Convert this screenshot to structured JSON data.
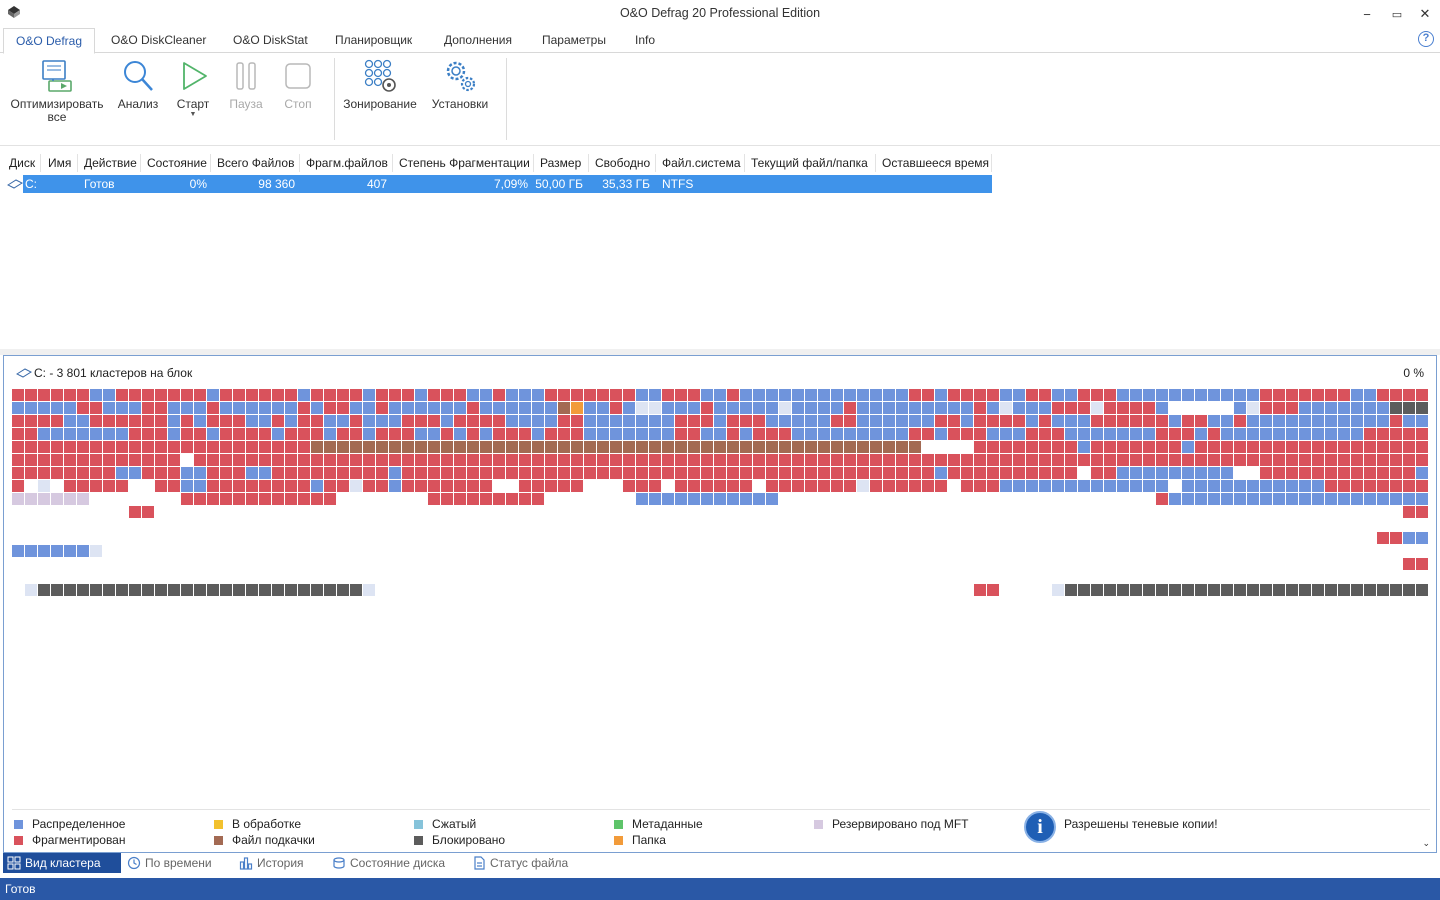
{
  "window": {
    "title": "O&O Defrag 20 Professional Edition",
    "minimize_glyph": "−",
    "maximize_glyph": "▭",
    "close_glyph": "✕"
  },
  "menu": {
    "tabs": [
      "O&O Defrag",
      "O&O DiskCleaner",
      "O&O DiskStat",
      "Планировщик",
      "Дополнения",
      "Параметры",
      "Info"
    ],
    "active_index": 0,
    "help_glyph": "?"
  },
  "ribbon": {
    "optimize_all_line1": "Оптимизировать",
    "optimize_all_line2": "все",
    "analyze": "Анализ",
    "start": "Старт",
    "start_caret": "▼",
    "pause": "Пауза",
    "stop": "Стоп",
    "zoning": "Зонирование",
    "settings": "Установки"
  },
  "drive_table": {
    "columns": [
      "Диск",
      "Имя",
      "Действие",
      "Состояние",
      "Всего Файлов",
      "Фрагм.файлов",
      "Степень Фрагментации",
      "Размер",
      "Свободно",
      "Файл.система",
      "Текущий файл/папка",
      "Оставшееся время"
    ],
    "rows": [
      {
        "disk": "C:",
        "name": "",
        "action": "Готов",
        "state": "0%",
        "total_files": "98 360",
        "fragmented_files": "407",
        "fragmentation": "7,09%",
        "size": "50,00 ГБ",
        "free": "35,33 ГБ",
        "filesystem": "NTFS",
        "current": "",
        "remaining": ""
      }
    ]
  },
  "cluster_view": {
    "title": "C: - 3 801 кластеров на блок",
    "percent": "0 %",
    "colors": {
      "allocated": "#6f94dc",
      "fragmented": "#d9525c",
      "processing": "#f2c12e",
      "pagefile": "#a36a53",
      "compressed": "#86c3da",
      "locked": "#5c5c5c",
      "metadata": "#5ec46a",
      "folder": "#f29b3a",
      "mft_reserved": "#d6c9e0",
      "unused_light": "#dde4f3",
      "empty": "#ffffff"
    },
    "rows": [
      "FFFFFFAAFFFFFFFAFFFFFFAFFFFAFFFAFFFAAFAAAFFFFFFFAAFFFAAFAAAAAAAAAAAAAFFAFFFFAAFFAAFFFAAAAAAAAAAAFFFFFFFAAFFFFFFAAAAAAAAAAFFAFFFFAF",
      "AAAAAFFAAAFFAAAFAAAAAAFAFFAAFAAAAAAFAAAAAAPOAAFAUUAAAFAAAAAUAAAAFAAAAAAAAAFAUAAAFFFUFFFFAEEEEEAUFFFAAAAAAALLLLAAAAAAAAAAAAAAAAAAFFFF",
      "FFFFAAFFFFFFAFAFFFAAFAFFAAFAAAFFFAFFFFAAAAFFAAAAAAAFFFAFFFAAAAAFFAAAAAAFFAFFFFAFAAAFFFFFFAFFAAFAAAAAAAAAAAFAAAAAFAAAAAAAAFAAAAAFFAF",
      "FFAAAAAAAFFFAFFAFFFFAFFFAFFAFFFAAFAFAFFFAFFFAAAAAAAFFAAFAFFFAAAAAAAAAFFAFFFAAAFFFAAAAAAAFFFAFAAAAAAAAAAAFFFFFFFFAFAFFFFAAAAAFFFFFAFFFF",
      "FFFFFFFFFFFFFFFFFFFFFFFPPPPPPPPPPPPPPPPPPPPPPPPPPPPPPPPPPPPPPPPPPPPPPPEEEEFFFFFFFFAFFFFFFFAFFFFFFFFFFFFFFFFFFFFFFFFFFFFFFFFFFFFFFFFFFFFFFFFF",
      "FFFFFFFFFFFFFEFFFFFFFFFFFFFFFFFFFFFFFFFFFFFFFFFFFFFFFFFFFFFFFFFFFFFFFFFFFFFFFFFFFFFFFFFFFFFFFFFFFFFFFFFFFFFFFFFFFFFFFFFFFFFFFFFFFFFF",
      "FFFFFFFFAAFFFAAFFFAAFFFFFFFFFAFFFFFFFFFFFFFFFFFFFFFFFFFFFFFFFFFFFFFFFFFAFFFFFFFFFFEFFAAAAAAAAAEEFFFFFFFFFFFFAAAAAAAAAAAAAAAFFFFFFFFF",
      "FEUEFFFFFEEFFAAFFFFFFFFAFFUFFAFFFFFFFEEFFFFFEEEFFFEFFFFFFEFFFFFFFUFFFFFFEFFFAAAAAAAAAAAAAEAAAAAAAAAAAFFFFFFFFFFFFAAAAAAAAAAMMMMMMMMM",
      "MMMMMMEEEEEEEFFFFFFFFFFFFEEEEEEEFFFFFFFFFEEEEEEEAAAAAAAAAAAEEEEEEEEEEEEEEEEEEEEEEEEEEEEEFAAAAAAAAAAAAAAAAAAAAAAAAEEEEEEEEEEEEEEEEEEEEE",
      "EEEEEEEEEFFEEEEEEEEEEEEEEEEEEEEEEEEEEEEEEEEEEEEEEEEEEEEEEEEEEEEEEEEEEEEEEEEEEEEEEEEEEEEEEEEEEEEEEEEEEEEEEEEEEEEEEEEEEEEEEEEEEEEEEEEEE",
      "EEEEEEEEEEEEEEEEEEEEEEEEEEEEEEEEEEEEEEEEEEEEEEEEEEEEEEEEEEEEEEEEEEEEEEEEEEEEEEEEEEEEEEEEEEEEEEEEEEEEEEEEEEEEEEEEEEEEEEEEEEEEEEEEEEEEE",
      "EEEEEEEEEEEEEEEEEEEEEEEEEEEEEEEEEEEEEEEEEEEEEEEEEEEEEEEEEEEEEEEEEEEEEEEEEEEEEEEEEEEEEEEEEEEEEEEEEEEEEEEEEEEEEEEEEEEEEEEEEEEEEEEEEEEEE",
      "AAAAAAU",
      "EEEEEEEEEEEEEEEEEEEEEEEEEEEEEEEEEEEEEEEEEEEEEEEEEEEEEEEEEEEEEEEEEEEEEEEEEEEEEEEEEEEEEEEEEEEEEEEEEEEEEEEEEEEEEEEEEEEEEEEEEEEEEEEEEEEEE",
      "EEEEEEEEEEEEEEEEEEEEEEEEEEEEEEEEEEEEEEEEEEEEEEEEEEEEEEEEEEEEEEEEEEEEEEEEEEEEEEEEEEEEEEEEEEEEEEEEEEEEEEEEEEEEEEEEEEEEEEEEEEEEEEEEEEEE",
      "EKLLLLLLLLLLLLLLLLLLLLLLLLLKEEEEEEEEEEEEEEEEEEEEEEEEEEEEEEEEEEEEEEEEEEEEEEFFEEEEKLLLLLLLLLLLLLLLLLLLLLLLLLLLLLLLLLLLLLLLLLK"
    ],
    "extra_right": [
      {
        "row": 11,
        "cells": "FFAA"
      },
      {
        "row": 13,
        "cells": "FF"
      },
      {
        "row": 9,
        "cells": "FF"
      }
    ]
  },
  "legend": {
    "items": [
      {
        "label": "Распределенное",
        "color_key": "allocated"
      },
      {
        "label": "Фрагментирован",
        "color_key": "fragmented"
      },
      {
        "label": "В обработке",
        "color_key": "processing"
      },
      {
        "label": "Файл подкачки",
        "color_key": "pagefile"
      },
      {
        "label": "Сжатый",
        "color_key": "compressed"
      },
      {
        "label": "Блокировано",
        "color_key": "locked"
      },
      {
        "label": "Метаданные",
        "color_key": "metadata"
      },
      {
        "label": "Папка",
        "color_key": "folder"
      },
      {
        "label": "Резервировано под MFT",
        "color_key": "mft_reserved"
      }
    ],
    "info_glyph": "i",
    "info_text": "Разрешены теневые копии!",
    "scroll_glyph": "⌄"
  },
  "bottom_tabs": {
    "items": [
      "Вид кластера",
      "По времени",
      "История",
      "Состояние диска",
      "Статус файла"
    ],
    "active_index": 0
  },
  "status": {
    "text": "Готов"
  }
}
